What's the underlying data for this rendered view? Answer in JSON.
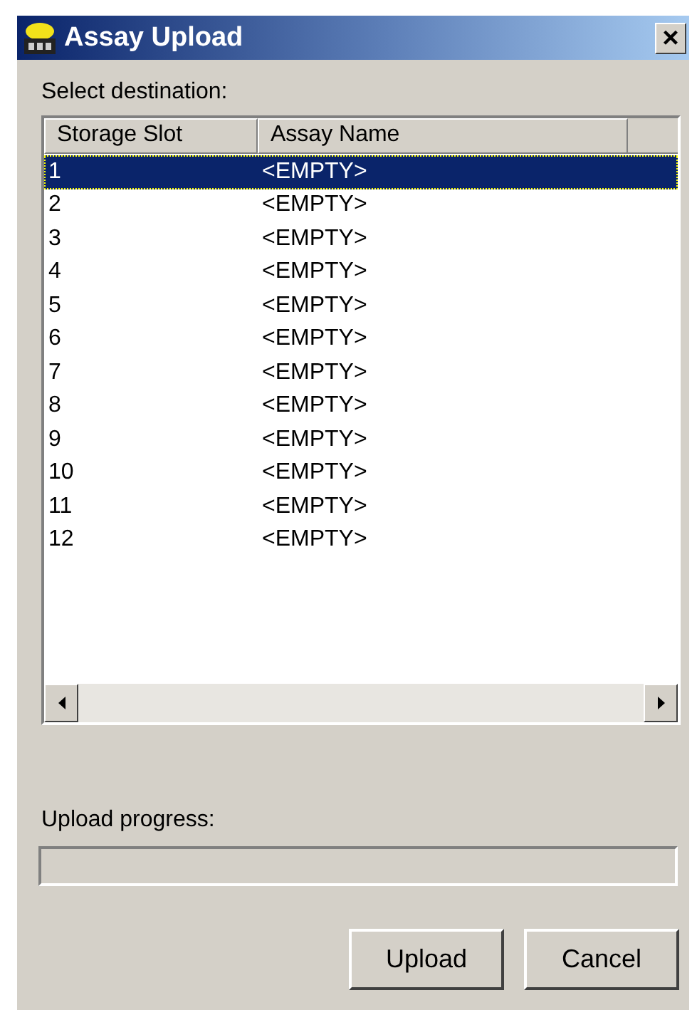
{
  "window": {
    "title": "Assay Upload",
    "close": "×"
  },
  "destination_label": "Select destination:",
  "table": {
    "columns": [
      "Storage Slot",
      "Assay Name"
    ],
    "rows": [
      {
        "slot": "1",
        "name": "<EMPTY>",
        "selected": true
      },
      {
        "slot": "2",
        "name": "<EMPTY>",
        "selected": false
      },
      {
        "slot": "3",
        "name": "<EMPTY>",
        "selected": false
      },
      {
        "slot": "4",
        "name": "<EMPTY>",
        "selected": false
      },
      {
        "slot": "5",
        "name": "<EMPTY>",
        "selected": false
      },
      {
        "slot": "6",
        "name": "<EMPTY>",
        "selected": false
      },
      {
        "slot": "7",
        "name": "<EMPTY>",
        "selected": false
      },
      {
        "slot": "8",
        "name": "<EMPTY>",
        "selected": false
      },
      {
        "slot": "9",
        "name": "<EMPTY>",
        "selected": false
      },
      {
        "slot": "10",
        "name": "<EMPTY>",
        "selected": false
      },
      {
        "slot": "11",
        "name": "<EMPTY>",
        "selected": false
      },
      {
        "slot": "12",
        "name": "<EMPTY>",
        "selected": false
      }
    ]
  },
  "progress": {
    "label": "Upload progress:",
    "level": 0
  },
  "buttons": [
    "Upload",
    "Cancel"
  ]
}
